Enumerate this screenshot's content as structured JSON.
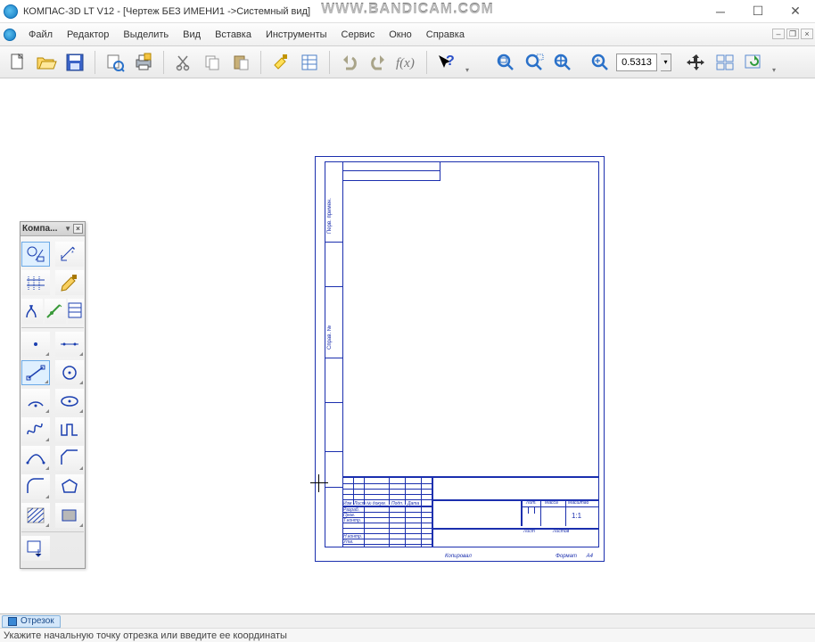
{
  "title": "КОМПАС-3D LT V12 - [Чертеж БЕЗ ИМЕНИ1 ->Системный вид]",
  "watermark": "WWW.BANDICAM.COM",
  "menu": {
    "file": "Файл",
    "editor": "Редактор",
    "select": "Выделить",
    "view": "Вид",
    "insert": "Вставка",
    "tools": "Инструменты",
    "service": "Сервис",
    "window": "Окно",
    "help": "Справка"
  },
  "toolbar": {
    "zoom_value": "0.5313"
  },
  "toolpanel": {
    "title": "Компа..."
  },
  "sheet": {
    "left1": "Перв. примен.",
    "left2": "Справ. №",
    "tb_izm": "Изм",
    "tb_list": "Лист",
    "tb_ndoc": "№ докум.",
    "tb_podp": "Подп.",
    "tb_data": "Дата",
    "tb_razrab": "Разраб.",
    "tb_prov": "Пров.",
    "tb_tkontr": "Т.контр.",
    "tb_nkontr": "Н.контр.",
    "tb_utv": "Утв.",
    "tb_lit": "Лит.",
    "tb_massa": "Масса",
    "tb_mashtab": "Масштаб",
    "tb_list2": "Лист",
    "tb_listov": "Листов",
    "tb_11": "1:1",
    "foot_mid": "Копировал",
    "foot_right": "Формат",
    "foot_fmt": "A4"
  },
  "tab": {
    "label": "Отрезок"
  },
  "status": {
    "text": "Укажите начальную точку отрезка или введите ее координаты"
  }
}
